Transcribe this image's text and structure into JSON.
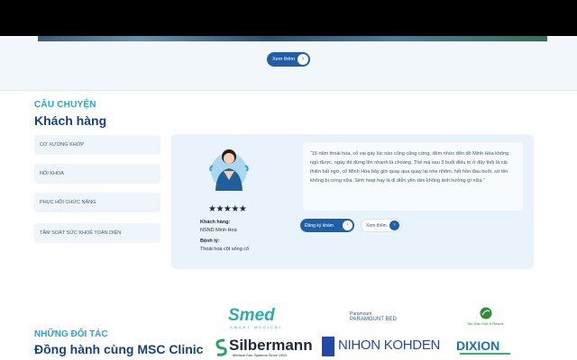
{
  "hero": {
    "see_more_label": "Xem thêm",
    "arrow_icon": "arrow-right-icon"
  },
  "stories": {
    "kicker": "CÂU CHUYỆN",
    "title": "Khách hàng",
    "categories": [
      "CƠ XƯƠNG KHỚP",
      "NỘI KHOA",
      "PHỤC HỒI CHỨC NĂNG",
      "TẦM SOÁT SỨC KHOẺ TOÀN DIỆN"
    ],
    "card": {
      "rating": 5,
      "stars": "★★★★★",
      "customer_label": "Khách hàng:",
      "customer_name": "NSND Minh Hoà",
      "condition_label": "Bệnh lý:",
      "condition": "Thoái hoá cột sống cổ",
      "quote": "“15 năm thoái hóa, cổ vai gáy lúc nào cũng căng cứng, đêm nhức đến độ Minh Hòa không ngủ được, ngày thì đứng lên nhanh là choáng. Thế mà sau 3 buổi điều trị ở đây thôi là cải thiện bất ngờ, cổ Minh Hòa bây giờ quay qua quay lại nhẹ nhõm, hết hồn đau buốt, sờ lên không bị cứng nữa. Sinh hoạt hay là đi diễn yên tâm không ảnh hưởng gì nữa.”",
      "register_label": "Đăng ký khám",
      "more_label": "Xem thêm"
    }
  },
  "partners": {
    "kicker": "NHỮNG ĐỐI TÁC",
    "title": "Đồng hành cùng MSC Clinic",
    "logos": {
      "smed": "Smed",
      "smed_sub": "SMART MEDICAL",
      "paramount_top": "Paramount",
      "paramount": "PARAMOUNT BED",
      "golf": "Tan Dao Golf & Resort",
      "silbermann": "Silbermann",
      "silbermann_sub": "Medical Gas Systems Since 1953",
      "nihon": "NIHON KOHDEN",
      "dixion": "DIXION"
    }
  },
  "colors": {
    "primary": "#1f5fa8",
    "accent": "#2aa0d8",
    "heading": "#17417a"
  }
}
